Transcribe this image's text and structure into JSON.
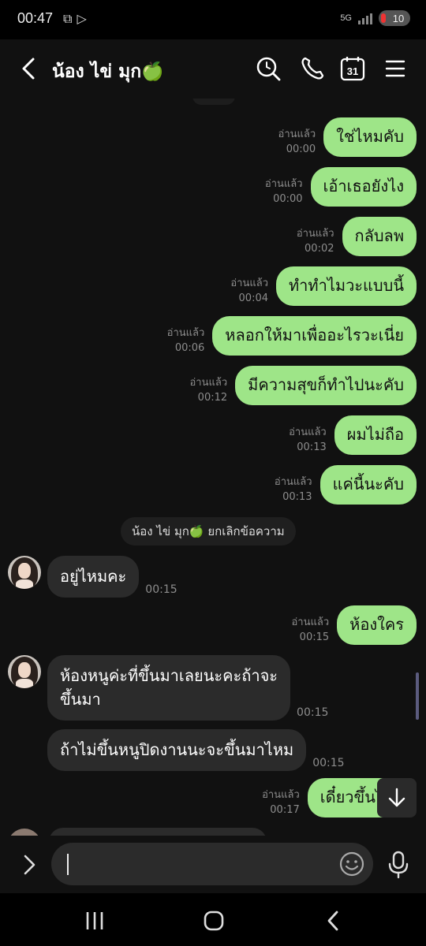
{
  "status_bar": {
    "time": "00:47",
    "network_label": "5G",
    "battery_level": "10"
  },
  "header": {
    "contact_name": "น้อง ไข่ มุก🍏",
    "icons": [
      "back-icon",
      "search-icon",
      "phone-icon",
      "calendar-icon",
      "menu-icon"
    ],
    "calendar_day": "31"
  },
  "messages_out": [
    {
      "read": "อ่านแล้ว",
      "time": "00:00",
      "text": "ใช่ไหมคับ"
    },
    {
      "read": "อ่านแล้ว",
      "time": "00:00",
      "text": "เอ้าเธอยังไง"
    },
    {
      "read": "อ่านแล้ว",
      "time": "00:02",
      "text": "กลับลพ"
    },
    {
      "read": "อ่านแล้ว",
      "time": "00:04",
      "text": "ทำทำไมวะแบบนี้"
    },
    {
      "read": "อ่านแล้ว",
      "time": "00:06",
      "text": "หลอกให้มาเพื่ออะไรวะเนี่ย"
    },
    {
      "read": "อ่านแล้ว",
      "time": "00:12",
      "text": "มีความสุขก็ทำไปนะคับ"
    },
    {
      "read": "อ่านแล้ว",
      "time": "00:13",
      "text": "ผมไม่ถือ"
    },
    {
      "read": "อ่านแล้ว",
      "time": "00:13",
      "text": "แค่นี้นะคับ"
    }
  ],
  "system_message": "น้อง ไข่ มุก🍏 ยกเลิกข้อความ",
  "message_in_1": {
    "text": "อยู่ไหมคะ",
    "time": "00:15"
  },
  "message_out_9": {
    "read": "อ่านแล้ว",
    "time": "00:15",
    "text": "ห้องใคร"
  },
  "message_in_2": {
    "line1": "ห้องหนูค่ะที่ขึ้นมาเลยนะคะถ้าจะ",
    "line2": "ขึ้นมา",
    "time": "00:15"
  },
  "message_in_3": {
    "text": "ถ้าไม่ขึ้นหนูปิดงานนะจะขึ้นมาไหม",
    "time": "00:15"
  },
  "message_out_10": {
    "read": "อ่านแล้ว",
    "time": "00:17",
    "text": "เดี๋ยวขึ้นไปค"
  },
  "colors": {
    "outgoing_bubble": "#9ee588",
    "incoming_bubble": "#2b2b2b",
    "background": "#111111"
  }
}
